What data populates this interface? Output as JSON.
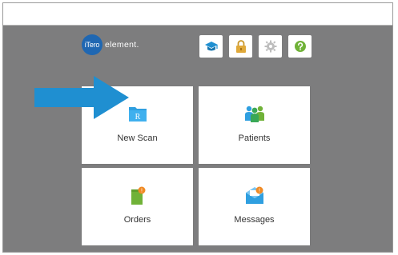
{
  "logo": {
    "badge_text": "iTero",
    "product_text": "element."
  },
  "toolbar": {
    "buttons": [
      {
        "name": "training",
        "icon": "graduation-cap-icon",
        "color": "#1f8fd1"
      },
      {
        "name": "lock",
        "icon": "lock-icon",
        "color": "#d9a02a"
      },
      {
        "name": "settings",
        "icon": "gear-icon",
        "color": "#b7b7b7"
      },
      {
        "name": "help",
        "icon": "question-icon",
        "color": "#70b238"
      }
    ]
  },
  "tiles": {
    "new_scan": {
      "label": "New Scan",
      "icon": "folder-scan-icon",
      "icon_letter": "R",
      "color": "#2f9fe0"
    },
    "patients": {
      "label": "Patients",
      "icon": "patients-icon",
      "color": "#3aa857"
    },
    "orders": {
      "label": "Orders",
      "icon": "orders-icon",
      "badge": "!",
      "color": "#70b238",
      "badge_color": "#f08a24"
    },
    "messages": {
      "label": "Messages",
      "icon": "messages-icon",
      "badge": "!",
      "color": "#2f9fe0",
      "badge_color": "#f08a24"
    }
  },
  "annotation": {
    "arrow_color": "#1f8fd1",
    "target": "New Scan"
  }
}
